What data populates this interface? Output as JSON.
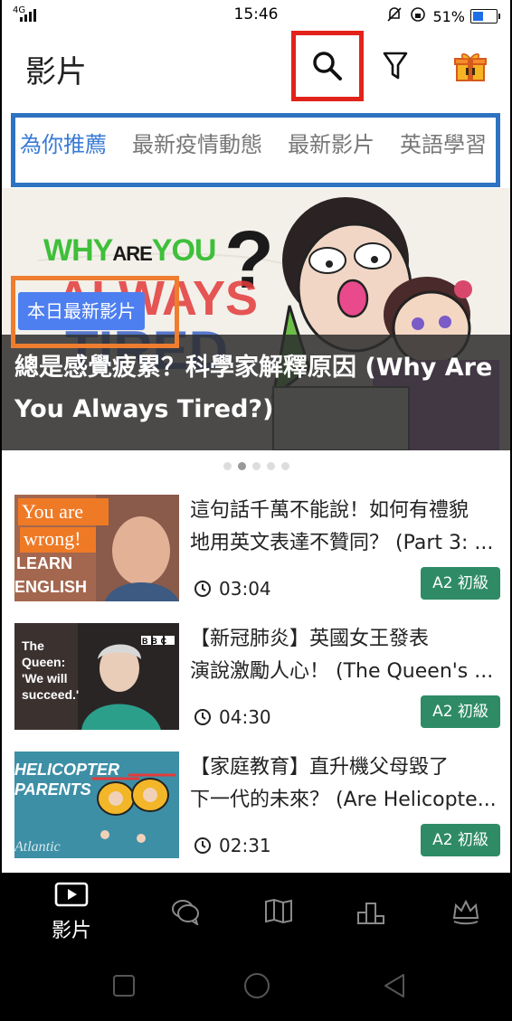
{
  "status": {
    "network": "4G",
    "time": "15:46",
    "battery": "51%",
    "battery_level": 0.51
  },
  "header": {
    "title": "影片",
    "icons": [
      "search-icon",
      "filter-icon",
      "gift-icon"
    ]
  },
  "tabs": [
    {
      "label": "為你推薦",
      "active": true
    },
    {
      "label": "最新疫情動態",
      "active": false
    },
    {
      "label": "最新影片",
      "active": false
    },
    {
      "label": "英語學習",
      "active": false
    }
  ],
  "hero": {
    "badge": "本日最新影片",
    "title": "總是感覺疲累？科學家解釋原因 (Why Are You Always Tired?)",
    "art_text": "WHY ARE YOU ALWAYS TIRED",
    "dots_count": 5,
    "active_dot": 2
  },
  "videos": [
    {
      "title_line1": "這句話千萬不能說！如何有禮貌",
      "title_line2": "地用英文表達不贊同？ (Part 3: ...",
      "duration": "03:04",
      "level": "A2 初級",
      "thumb_text1": "You are",
      "thumb_text2": "wrong!",
      "thumb_text3": "LEARN",
      "thumb_text4": "ENGLISH"
    },
    {
      "title_line1": "【新冠肺炎】英國女王發表",
      "title_line2": "演說激勵人心！ (The Queen's ...",
      "duration": "04:30",
      "level": "A2 初級",
      "thumb_text1": "The",
      "thumb_text2": "Queen:",
      "thumb_text3": "'We will",
      "thumb_text4": "succeed.'",
      "thumb_logo": "BBC"
    },
    {
      "title_line1": "【家庭教育】直升機父母毀了",
      "title_line2": "下一代的未來？ (Are Helicopte...",
      "duration": "02:31",
      "level": "A2 初級",
      "thumb_text1": "HELICOPTER",
      "thumb_text2": "PARENTS",
      "thumb_text3": "Atlantic"
    }
  ],
  "bottom_nav": [
    {
      "label": "影片",
      "icon": "play-icon",
      "active": true
    },
    {
      "label": "",
      "icon": "chat-icon",
      "active": false
    },
    {
      "label": "",
      "icon": "book-icon",
      "active": false
    },
    {
      "label": "",
      "icon": "podium-icon",
      "active": false
    },
    {
      "label": "",
      "icon": "crown-icon",
      "active": false
    }
  ],
  "colors": {
    "accent": "#3a7bd5",
    "level_badge": "#2e8b66",
    "annotation_red": "#e2231a",
    "annotation_blue": "#2d73c1",
    "annotation_orange": "#ee7d2f"
  }
}
